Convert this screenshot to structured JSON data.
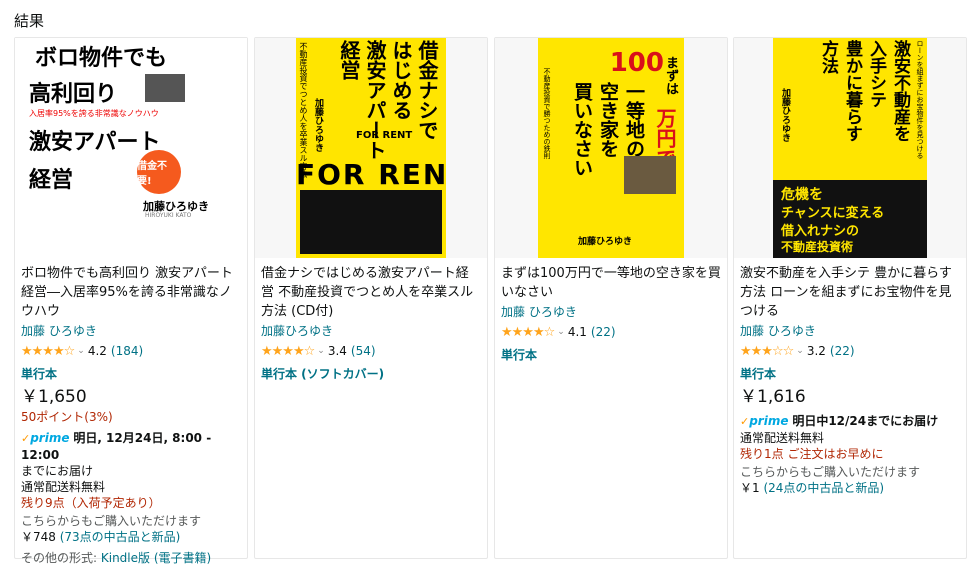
{
  "heading": "結果",
  "colors": {
    "link": "#007185",
    "star": "#ffa41c",
    "alert": "#b12704",
    "prime": "#00a8e1",
    "yellow": "#ffe500"
  },
  "products": [
    {
      "title": "ボロ物件でも高利回り 激安アパート経営―入居率95%を誇る非常識なノウハウ",
      "author": "加藤 ひろゆき",
      "stars": "★★★★☆",
      "rating": "4.2",
      "rating_count": "(184)",
      "format": "単行本",
      "price": "￥1,650",
      "points": "50ポイント(3%)",
      "prime_logo": "prime",
      "prime_delivery": "明日, 12月24日, 8:00 - 12:00",
      "prime_suffix": "までにお届け",
      "shipping": "通常配送料無料",
      "stock": "残り9点（入荷予定あり）",
      "other_buy": "こちらからもご購入いただけます",
      "used_price": "￥748",
      "used_link": "(73点の中古品と新品)",
      "other_formats_label": "その他の形式:",
      "other_formats_link": "Kindle版 (電子書籍)",
      "cover": {
        "line1": "ボロ物件でも",
        "line2": "高利回り",
        "tagline": "入居率95%を誇る非常識なノウハウ",
        "line3": "激安アパート",
        "line4": "経営",
        "badge": "借金不要!",
        "author": "加藤ひろゆき",
        "author_romaji": "HIROYUKI KATO"
      }
    },
    {
      "title": "借金ナシではじめる激安アパート経営 不動産投資でつとめ人を卒業スル方法 (CD付)",
      "author": "加藤ひろゆき",
      "stars": "★★★★☆",
      "rating": "3.4",
      "rating_count": "(54)",
      "format": "単行本 (ソフトカバー)",
      "cover": {
        "col1": "借金ナシで",
        "col2": "はじめる",
        "col3": "激安アパート",
        "col4": "経営",
        "sub": "不動産投資でつとめ人を卒業スル方法",
        "author": "加藤ひろゆき",
        "for_rent": "FOR RENT",
        "rent_big": "FOR RENT"
      }
    },
    {
      "title": "まずは100万円で一等地の空き家を買いなさい",
      "author": "加藤 ひろゆき",
      "stars": "★★★★☆",
      "rating": "4.1",
      "rating_count": "(22)",
      "format": "単行本",
      "cover": {
        "small": "まずは",
        "big_num": "100",
        "big_unit": "万円で",
        "col_a": "一等地の",
        "col_b": "空き家を",
        "col_c": "買いなさい",
        "sub": "不動産投資で勝つための鉄則",
        "author": "加藤ひろゆき"
      }
    },
    {
      "title": "激安不動産を入手シテ 豊かに暮らす方法 ローンを組まずにお宝物件を見つける",
      "author": "加藤 ひろゆき",
      "stars": "★★★☆☆",
      "rating": "3.2",
      "rating_count": "(22)",
      "format": "単行本",
      "price": "￥1,616",
      "prime_logo": "prime",
      "prime_delivery": "明日中12/24までにお届け",
      "shipping": "通常配送料無料",
      "stock": "残り1点 ご注文はお早めに",
      "other_buy": "こちらからもご購入いただけます",
      "used_price": "￥1",
      "used_link": "(24点の中古品と新品)",
      "cover": {
        "col_a": "激安不動産を",
        "col_b": "入手シテ",
        "col_c": "豊かに暮らす",
        "col_d": "方法",
        "top": "ローンを組まずにお宝物件を見つける",
        "author": "加藤ひろゆき",
        "band1": "危機を",
        "band2": "チャンスに変える",
        "band3": "借入れナシの",
        "band4": "不動産投資術"
      }
    }
  ]
}
